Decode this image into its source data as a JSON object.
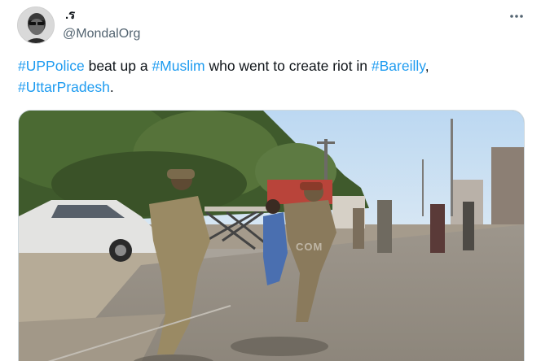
{
  "tweet": {
    "display_name": ".ร",
    "handle": "@MondalOrg",
    "text_parts": [
      {
        "text": "#UPPolice",
        "tag": true
      },
      {
        "text": " beat up a ",
        "tag": false
      },
      {
        "text": "#Muslim",
        "tag": true
      },
      {
        "text": " who went to create riot in ",
        "tag": false
      },
      {
        "text": "#Bareilly",
        "tag": true
      },
      {
        "text": ", ",
        "tag": false
      },
      {
        "text": "#UttarPradesh",
        "tag": true
      },
      {
        "text": ".",
        "tag": false
      }
    ],
    "media_watermark": "COM"
  },
  "icons": {
    "more": "more-options-icon",
    "avatar": "avatar"
  },
  "colors": {
    "hashtag": "#1d9bf0",
    "text": "#0f1419",
    "muted": "#536471"
  }
}
